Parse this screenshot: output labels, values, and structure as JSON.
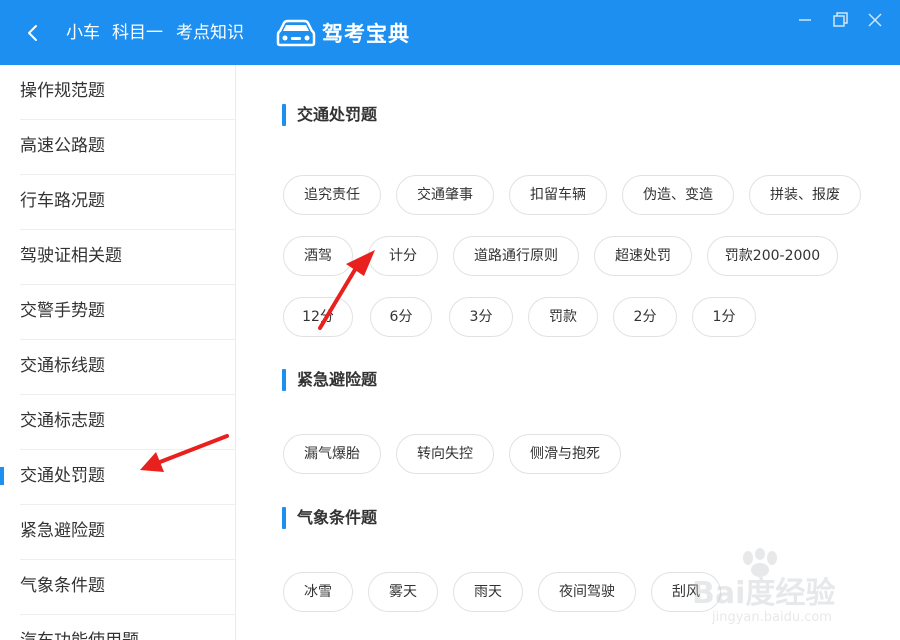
{
  "titlebar": {
    "crumbs": [
      "小车",
      "科目一",
      "考点知识"
    ],
    "app_name": "驾考宝典",
    "bg_color": "#1c8ff0"
  },
  "sidebar": {
    "items": [
      {
        "label": "操作规范题"
      },
      {
        "label": "高速公路题"
      },
      {
        "label": "行车路况题"
      },
      {
        "label": "驾驶证相关题"
      },
      {
        "label": "交警手势题"
      },
      {
        "label": "交通标线题"
      },
      {
        "label": "交通标志题"
      },
      {
        "label": "交通处罚题",
        "active": true
      },
      {
        "label": "紧急避险题"
      },
      {
        "label": "气象条件题"
      },
      {
        "label": "汽车功能使用题"
      }
    ]
  },
  "sections": [
    {
      "title": "交通处罚题",
      "tags": [
        "追究责任",
        "交通肇事",
        "扣留车辆",
        "伪造、变造",
        "拼装、报废",
        "酒驾",
        "计分",
        "道路通行原则",
        "超速处罚",
        "罚款200-2000",
        "12分",
        "6分",
        "3分",
        "罚款",
        "2分",
        "1分"
      ]
    },
    {
      "title": "紧急避险题",
      "tags": [
        "漏气爆胎",
        "转向失控",
        "侧滑与抱死"
      ]
    },
    {
      "title": "气象条件题",
      "tags": [
        "冰雪",
        "雾天",
        "雨天",
        "夜间驾驶",
        "刮风"
      ]
    }
  ],
  "watermark": {
    "text": "Bai度经验",
    "url": "jingyan.baidu.com"
  },
  "accent_color": "#1c8ff0",
  "annotation_color": "#e8201e"
}
